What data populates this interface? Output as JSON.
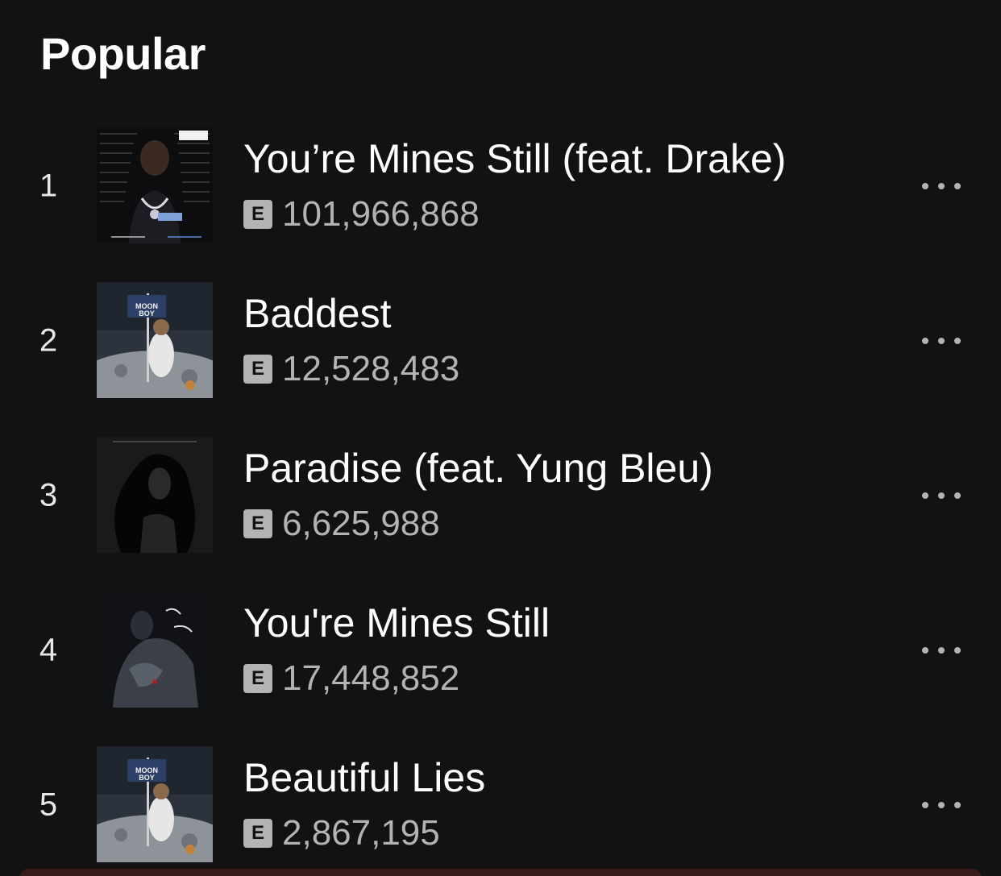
{
  "section": {
    "title": "Popular"
  },
  "tracks": [
    {
      "index": "1",
      "title": "You’re Mines Still (feat. Drake)",
      "explicit_label": "E",
      "plays": "101,966,868",
      "cover_icon": "album-cover-youre-mines-still-feat-drake"
    },
    {
      "index": "2",
      "title": "Baddest",
      "explicit_label": "E",
      "plays": "12,528,483",
      "cover_icon": "album-cover-moon-boy"
    },
    {
      "index": "3",
      "title": "Paradise (feat. Yung Bleu)",
      "explicit_label": "E",
      "plays": "6,625,988",
      "cover_icon": "album-cover-paradise"
    },
    {
      "index": "4",
      "title": "You're Mines Still",
      "explicit_label": "E",
      "plays": "17,448,852",
      "cover_icon": "album-cover-love-scars"
    },
    {
      "index": "5",
      "title": "Beautiful Lies",
      "explicit_label": "E",
      "plays": "2,867,195",
      "cover_icon": "album-cover-moon-boy"
    }
  ],
  "colors": {
    "background": "#121212",
    "primary_text": "#ffffff",
    "secondary_text": "#b3b3b3",
    "explicit_badge": "#b3b3b3"
  }
}
